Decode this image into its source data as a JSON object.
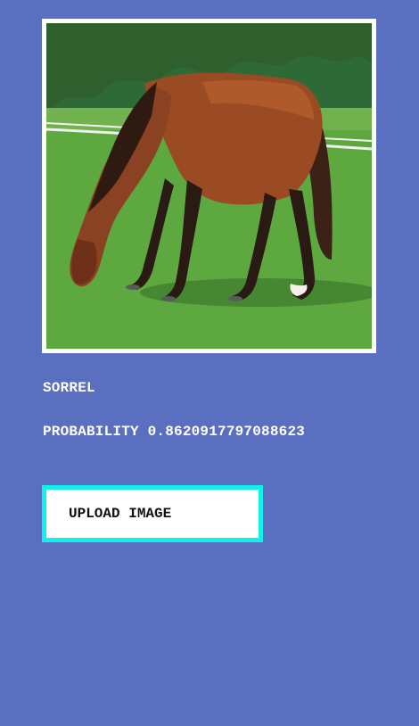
{
  "result": {
    "class_label": "SORREL",
    "probability_text": "PROBABILITY 0.8620917797088623"
  },
  "actions": {
    "upload_label": "UPLOAD IMAGE"
  },
  "colors": {
    "background": "#5a6fc0",
    "button_border": "#11f1ec",
    "text": "#ffffff"
  }
}
